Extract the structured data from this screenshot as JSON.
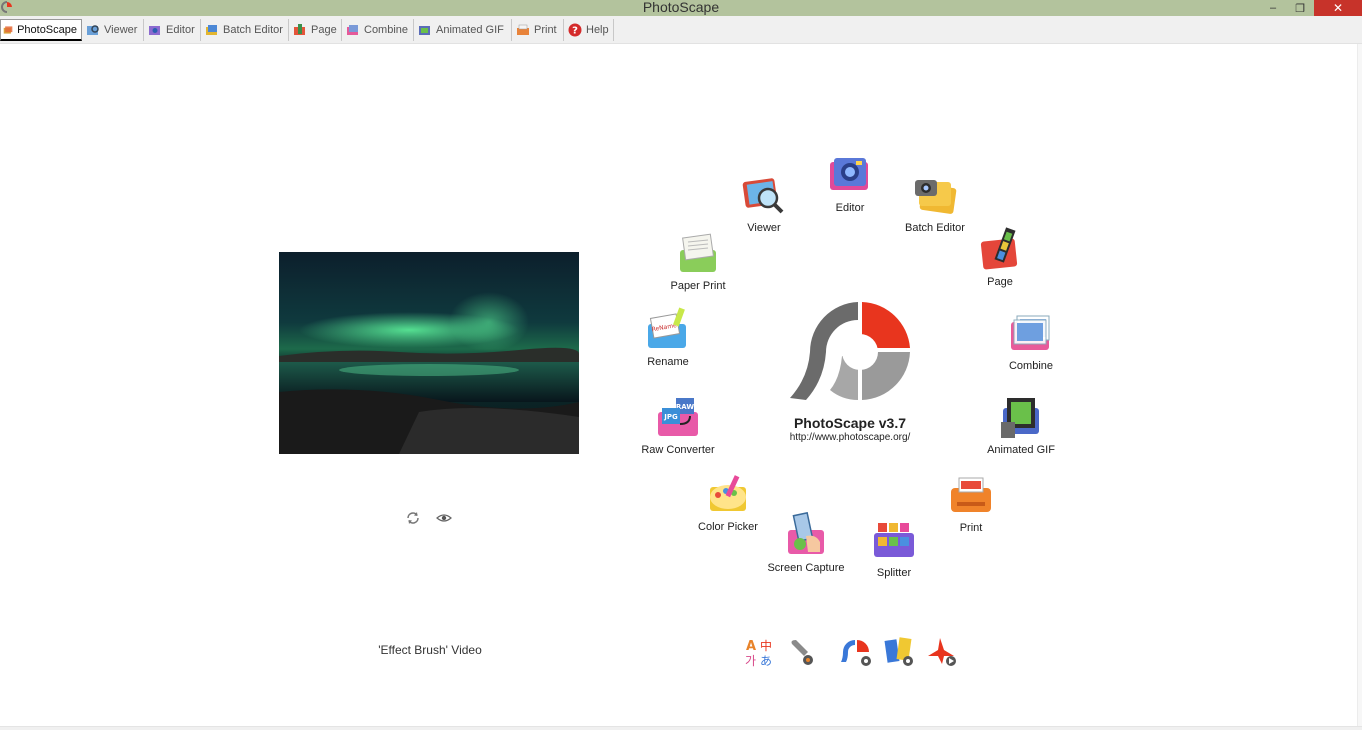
{
  "window": {
    "title": "PhotoScape",
    "minimize": "–",
    "maximize": "❐",
    "close": "✕"
  },
  "tabs": [
    {
      "label": "PhotoScape",
      "icon": "photoscape-tab-icon",
      "active": true
    },
    {
      "label": "Viewer",
      "icon": "viewer-tab-icon"
    },
    {
      "label": "Editor",
      "icon": "editor-tab-icon"
    },
    {
      "label": "Batch Editor",
      "icon": "batch-editor-tab-icon"
    },
    {
      "label": "Page",
      "icon": "page-tab-icon"
    },
    {
      "label": "Combine",
      "icon": "combine-tab-icon"
    },
    {
      "label": "Animated GIF",
      "icon": "animated-gif-tab-icon"
    },
    {
      "label": "Print",
      "icon": "print-tab-icon"
    },
    {
      "label": "Help",
      "icon": "help-tab-icon"
    }
  ],
  "main": {
    "photo_caption": "'Effect Brush' Video",
    "logo_name": "PhotoScape v3.7",
    "logo_url": "http://www.photoscape.org/"
  },
  "modules": {
    "viewer": "Viewer",
    "editor": "Editor",
    "batch_editor": "Batch Editor",
    "page": "Page",
    "combine": "Combine",
    "animated_gif": "Animated GIF",
    "print": "Print",
    "splitter": "Splitter",
    "screen_capture": "Screen Capture",
    "color_picker": "Color Picker",
    "raw_converter": "Raw Converter",
    "rename": "Rename",
    "paper_print": "Paper Print"
  },
  "bottom_icons": {
    "language_text": "A中가あ"
  },
  "colors": {
    "titlebar": "#b3c39d",
    "logo_red": "#e8351e",
    "logo_gray": "#6b6b6b",
    "close_red": "#c7332a"
  }
}
